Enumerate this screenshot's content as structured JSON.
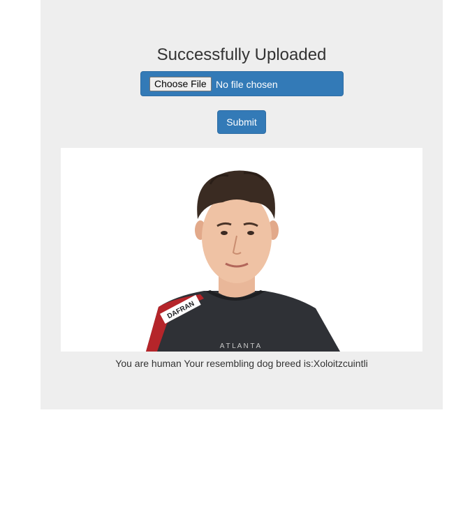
{
  "page": {
    "title": "Successfully Uploaded",
    "file_input": {
      "button_label": "Choose File",
      "status": "No file chosen"
    },
    "submit_label": "Submit",
    "photo": {
      "jersey_text": "A T L A N T A",
      "sponsor_text": "DAFRAN"
    },
    "result_text": "You are human Your resembling dog breed is:Xoloitzcuintli"
  },
  "colors": {
    "panel_bg": "#eeeeee",
    "primary_button": "#337ab7",
    "text": "#333333"
  }
}
